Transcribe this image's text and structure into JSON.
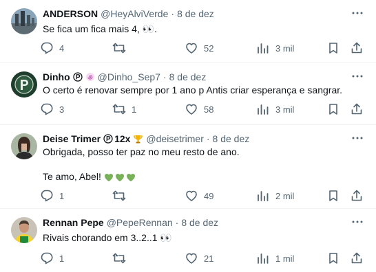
{
  "tweets": [
    {
      "name": "ANDERSON",
      "handle": "@HeyAlviVerde",
      "dot": "·",
      "date": "8 de dez",
      "text_lines": [
        "Se fica um fica mais 4, 👀."
      ],
      "replies": "4",
      "retweets": "",
      "likes": "52",
      "views": "3 mil"
    },
    {
      "name": "Dinho",
      "handle": "@Dinho_Sep7",
      "dot": "·",
      "date": "8 de dez",
      "text_lines": [
        "O certo é renovar sempre por 1 ano p Antis criar esperança e sangrar."
      ],
      "replies": "3",
      "retweets": "1",
      "likes": "58",
      "views": "3 mil"
    },
    {
      "name": "Deise Trimer",
      "badge_text": "12x",
      "handle": "@deisetrimer",
      "dot": "·",
      "date": "8 de dez",
      "text_lines": [
        "Obrigada, posso ter paz no meu resto de ano.",
        "Te amo, Abel!"
      ],
      "replies": "1",
      "retweets": "",
      "likes": "49",
      "views": "2 mil"
    },
    {
      "name": "Rennan Pepe",
      "handle": "@PepeRennan",
      "dot": "·",
      "date": "8 de dez",
      "text_lines": [
        "Rivais chorando em 3..2..1 👀"
      ],
      "replies": "1",
      "retweets": "",
      "likes": "21",
      "views": "1 mil"
    }
  ],
  "colors": {
    "text": "#0f1419",
    "muted": "#536471",
    "divider": "#eff3f4",
    "green_heart": "#78b159"
  },
  "icons": [
    "more-icon",
    "reply-icon",
    "retweet-icon",
    "like-icon",
    "views-icon",
    "bookmark-icon",
    "share-icon",
    "palmeiras-badge-icon",
    "spiral-icon",
    "trophy-icon",
    "green-heart-icon"
  ]
}
